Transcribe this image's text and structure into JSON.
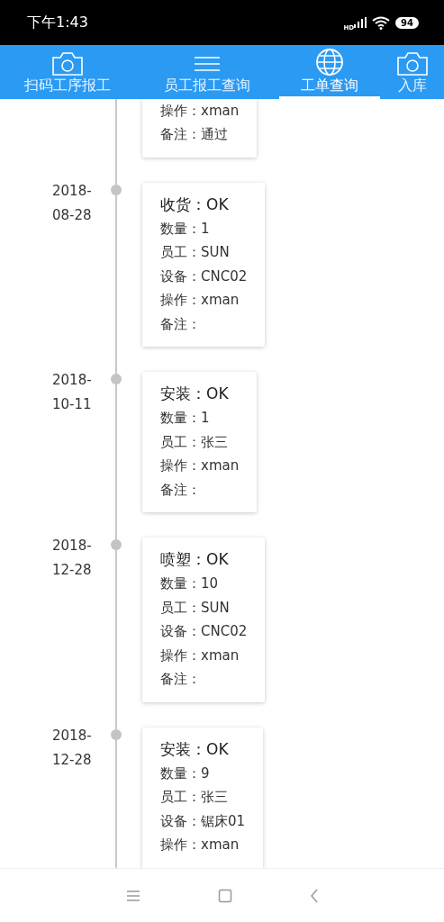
{
  "status_bar": {
    "time": "下午1:43",
    "network": "HD",
    "battery": "94"
  },
  "tabs": [
    {
      "label": "扫码工序报工",
      "kind": "camera",
      "selected": false
    },
    {
      "label": "员工报工查询",
      "kind": "menu",
      "selected": false
    },
    {
      "label": "工单查询",
      "kind": "globe",
      "selected": true
    },
    {
      "label": "入库",
      "kind": "camera",
      "selected": false
    }
  ],
  "timeline": [
    {
      "lines": [
        "操作：xman",
        "备注：通过"
      ]
    },
    {
      "date": "2018-08-28",
      "title": "收货：OK",
      "lines": [
        "数量：1",
        "员工：SUN",
        "设备：CNC02",
        "操作：xman",
        "备注："
      ]
    },
    {
      "date": "2018-10-11",
      "title": "安装：OK",
      "lines": [
        "数量：1",
        "员工：张三",
        "操作：xman",
        "备注："
      ]
    },
    {
      "date": "2018-12-28",
      "title": "喷塑：OK",
      "lines": [
        "数量：10",
        "员工：SUN",
        "设备：CNC02",
        "操作：xman",
        "备注："
      ]
    },
    {
      "date": "2018-12-28",
      "title": "安装：OK",
      "lines": [
        "数量：9",
        "员工：张三",
        "设备：锯床01",
        "操作：xman"
      ]
    }
  ]
}
